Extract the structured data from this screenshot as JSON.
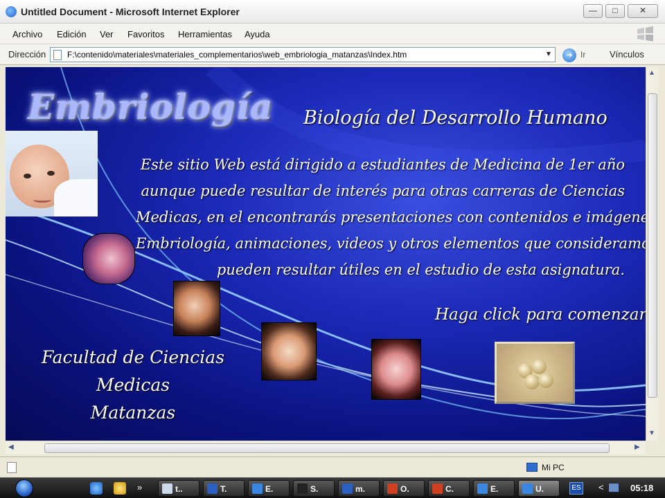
{
  "window": {
    "title": "Untitled Document - Microsoft Internet Explorer",
    "controls": {
      "minimize": "—",
      "maximize": "□",
      "close": "✕"
    }
  },
  "menu": [
    "Archivo",
    "Edición",
    "Ver",
    "Favoritos",
    "Herramientas",
    "Ayuda"
  ],
  "address": {
    "label": "Dirección",
    "url": "F:\\contenido\\materiales\\materiales_complementarios\\web_embriologia_matanzas\\Index.htm",
    "go": "Ir",
    "links": "Vínculos"
  },
  "page": {
    "logo": "Embriología",
    "subtitle": "Biología del Desarrollo Humano",
    "description": [
      "Este sitio Web está dirigido a estudiantes de Medicina de 1er año",
      "aunque puede resultar de interés para otras carreras de Ciencias",
      "Medicas, en el encontrarás presentaciones con contenidos  e imágenes de",
      "Embriología, animaciones, videos y otros elementos que consideramos te",
      "pueden resultar útiles en el estudio de esta asignatura."
    ],
    "cta": "Haga click para comenzar",
    "faculty": [
      "Facultad de Ciencias Medicas",
      "Matanzas"
    ]
  },
  "status": {
    "zone": "Mi PC"
  },
  "taskbar": {
    "more": "»",
    "tasks": [
      {
        "label": "t..",
        "color": "#cfd8e8"
      },
      {
        "label": "T.",
        "color": "#2b5fc0"
      },
      {
        "label": "E.",
        "color": "#3a86e0"
      },
      {
        "label": "S.",
        "color": "#222222"
      },
      {
        "label": "m.",
        "color": "#2b5fc0"
      },
      {
        "label": "O.",
        "color": "#d04020"
      },
      {
        "label": "C.",
        "color": "#d04020"
      },
      {
        "label": "E.",
        "color": "#3a86e0"
      },
      {
        "label": "U.",
        "color": "#3a86e0"
      }
    ],
    "lang": "ES",
    "tray_arrow": "<",
    "time": "05:18"
  }
}
